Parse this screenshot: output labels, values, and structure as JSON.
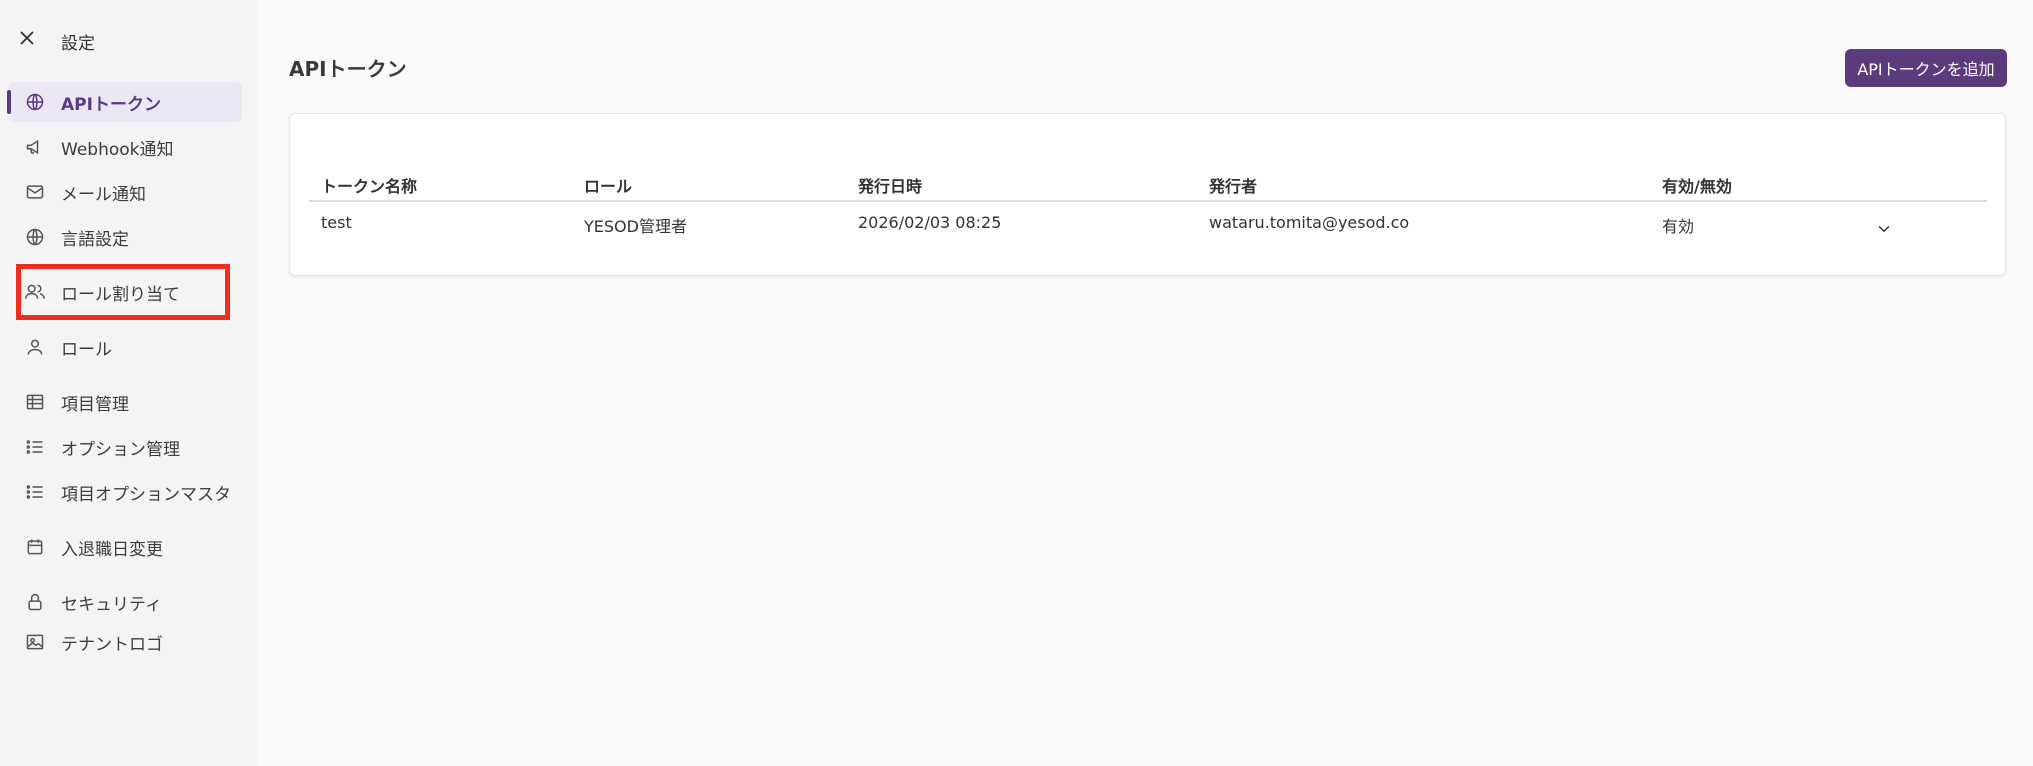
{
  "sidebar": {
    "title": "設定",
    "items": [
      {
        "label": "APIトークン",
        "icon": "globe-icon"
      },
      {
        "label": "Webhook通知",
        "icon": "megaphone-icon"
      },
      {
        "label": "メール通知",
        "icon": "mail-icon"
      },
      {
        "label": "言語設定",
        "icon": "globe-icon"
      },
      {
        "label": "ロール割り当て",
        "icon": "users-icon"
      },
      {
        "label": "ロール",
        "icon": "user-icon"
      },
      {
        "label": "項目管理",
        "icon": "table-icon"
      },
      {
        "label": "オプション管理",
        "icon": "list-icon"
      },
      {
        "label": "項目オプションマスタ",
        "icon": "list-icon"
      },
      {
        "label": "入退職日変更",
        "icon": "calendar-icon"
      },
      {
        "label": "セキュリティ",
        "icon": "lock-icon"
      },
      {
        "label": "テナントロゴ",
        "icon": "image-icon"
      }
    ]
  },
  "main": {
    "title": "APIトークン",
    "add_button": "APIトークンを追加"
  },
  "table": {
    "columns": [
      "トークン名称",
      "ロール",
      "発行日時",
      "発行者",
      "有効/無効"
    ],
    "rows": [
      [
        "test",
        "YESOD管理者",
        "2026/02/03 08:25",
        "wataru.tomita@yesod.co",
        "有効"
      ]
    ]
  },
  "colors": {
    "accent": "#5b3b7e",
    "active_bg": "#ece7f4",
    "highlight": "#ee2f1d"
  }
}
